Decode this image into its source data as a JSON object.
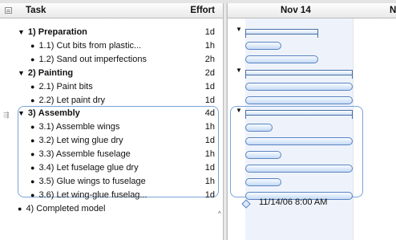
{
  "outline": {
    "col_task": "Task",
    "col_effort": "Effort",
    "rows": [
      {
        "num": "1)",
        "name": "Preparation",
        "effort": "1d"
      },
      {
        "num": "1.1)",
        "name": "Cut bits from plastic...",
        "effort": "1h"
      },
      {
        "num": "1.2)",
        "name": "Sand out imperfections",
        "effort": "2h"
      },
      {
        "num": "2)",
        "name": "Painting",
        "effort": "2d"
      },
      {
        "num": "2.1)",
        "name": "Paint bits",
        "effort": "1d"
      },
      {
        "num": "2.2)",
        "name": "Let paint dry",
        "effort": "1d"
      },
      {
        "num": "3)",
        "name": "Assembly",
        "effort": "4d"
      },
      {
        "num": "3.1)",
        "name": "Assemble wings",
        "effort": "1h"
      },
      {
        "num": "3.2)",
        "name": "Let wing glue dry",
        "effort": "1d"
      },
      {
        "num": "3.3)",
        "name": "Assemble fuselage",
        "effort": "1h"
      },
      {
        "num": "3.4)",
        "name": "Let fuselage glue dry",
        "effort": "1d"
      },
      {
        "num": "3.5)",
        "name": "Glue wings to fuselage",
        "effort": "1h"
      },
      {
        "num": "3.6)",
        "name": "Let wing-glue fuselag...",
        "effort": "1d"
      },
      {
        "num": "4)",
        "name": "Completed model",
        "effort": ""
      }
    ]
  },
  "gantt": {
    "date_header": "Nov 14",
    "next_header": "N",
    "milestone_label": "11/14/06 8:00 AM"
  }
}
